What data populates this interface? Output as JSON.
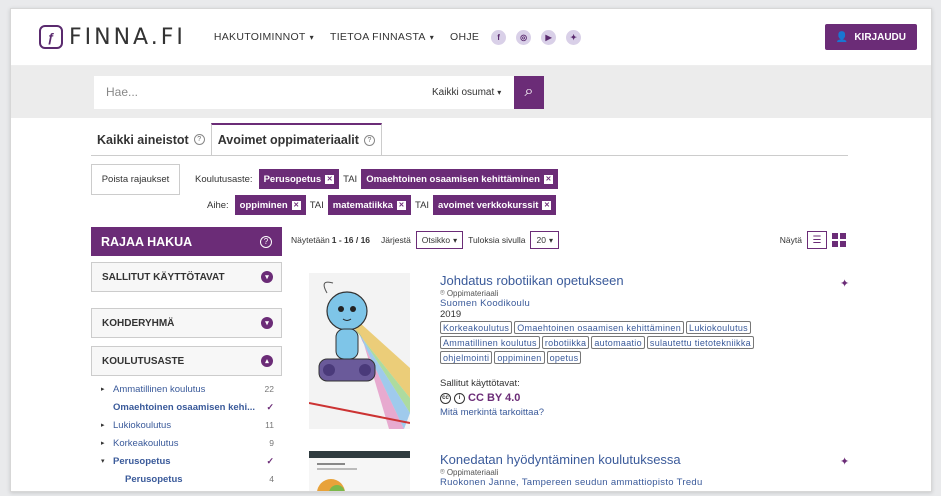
{
  "header": {
    "logo_text": "FINNA.FI",
    "nav": [
      {
        "label": "HAKUTOIMINNOT",
        "dropdown": true
      },
      {
        "label": "TIETOA FINNASTA",
        "dropdown": true
      },
      {
        "label": "OHJE",
        "dropdown": false
      }
    ],
    "social": [
      "facebook-icon",
      "instagram-icon",
      "youtube-icon",
      "twitter-icon"
    ],
    "login_label": "KIRJAUDU",
    "accent": "#6b2c77"
  },
  "search": {
    "placeholder": "Hae...",
    "scope": "Kaikki osumat"
  },
  "tabs": [
    {
      "label": "Kaikki aineistot",
      "active": false
    },
    {
      "label": "Avoimet oppimateriaalit",
      "active": true
    }
  ],
  "filters": {
    "remove_label": "Poista rajaukset",
    "level_label": "Koulutusaste:",
    "level_chips": [
      "Perusopetus",
      "Omaehtoinen osaamisen kehittäminen"
    ],
    "topic_label": "Aihe:",
    "topic_chips": [
      "oppiminen",
      "matematiikka",
      "avoimet verkkokurssit"
    ],
    "or": "TAI"
  },
  "sidebar": {
    "title": "RAJAA HAKUA",
    "facets": [
      "SALLITUT KÄYTTÖTAVAT",
      "KOHDERYHMÄ",
      "KOULUTUSASTE"
    ],
    "items": [
      {
        "label": "Ammatillinen koulutus",
        "count": "22",
        "expand": "▸",
        "selected": false
      },
      {
        "label": "Omaehtoinen osaamisen kehi...",
        "count": "✓",
        "expand": "",
        "selected": true
      },
      {
        "label": "Lukiokoulutus",
        "count": "11",
        "expand": "▸",
        "selected": false
      },
      {
        "label": "Korkeakoulutus",
        "count": "9",
        "expand": "▸",
        "selected": false
      },
      {
        "label": "Perusopetus",
        "count": "✓",
        "expand": "▾",
        "selected": true
      },
      {
        "label": "Perusopetus",
        "count": "4",
        "expand": "",
        "selected": true
      }
    ]
  },
  "results_bar": {
    "showing": "Näytetään",
    "range": "1 - 16 / 16",
    "sort_label": "Järjestä",
    "sort_value": "Otsikko",
    "per_page_label": "Tuloksia sivulla",
    "per_page_value": "20",
    "view_label": "Näytä"
  },
  "results": [
    {
      "title": "Johdatus robotiikan opetukseen",
      "type": "Oppimateriaali",
      "author": "Suomen Koodikoulu",
      "year": "2019",
      "tags": [
        "Korkeakoulutus",
        "Omaehtoinen osaamisen kehittäminen",
        "Lukiokoulutus",
        "Ammatillinen koulutus",
        "robotiikka",
        "automaatio",
        "sulautettu tietotekniikka",
        "ohjelmointi",
        "oppiminen",
        "opetus"
      ],
      "license_label": "Sallitut käyttötavat:",
      "license": "CC BY 4.0",
      "license_link": "Mitä merkintä tarkoittaa?"
    },
    {
      "title": "Konedatan hyödyntäminen koulutuksessa",
      "type": "Oppimateriaali",
      "author": "Ruokonen Janne, Tampereen seudun ammattiopisto Tredu"
    }
  ]
}
